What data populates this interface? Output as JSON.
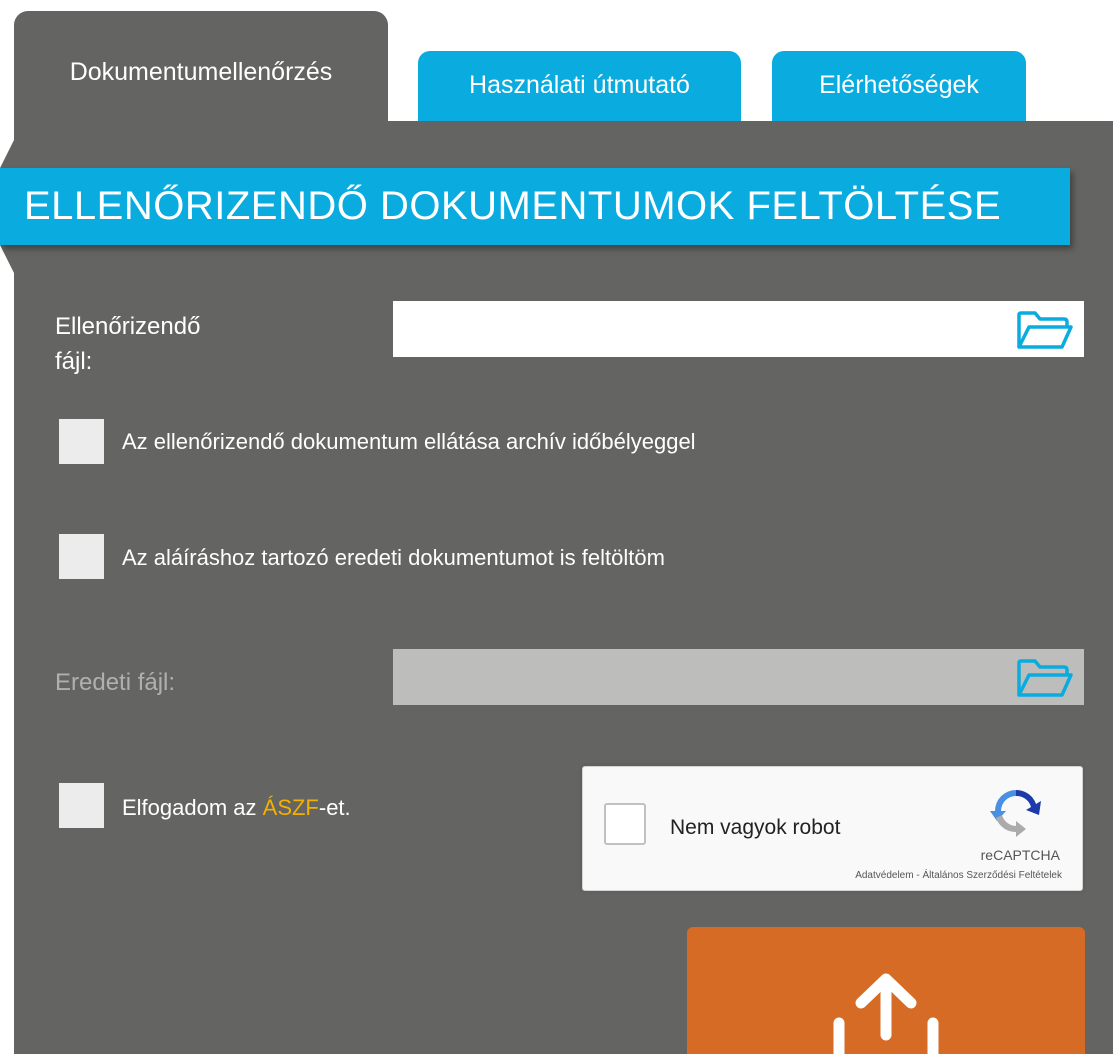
{
  "tabs": [
    {
      "label": "Dokumentumellenőrzés",
      "active": true
    },
    {
      "label": "Használati útmutató",
      "active": false
    },
    {
      "label": "Elérhetőségek",
      "active": false
    }
  ],
  "banner": {
    "title": "ELLENŐRIZENDŐ DOKUMENTUMOK FELTÖLTÉSE"
  },
  "form": {
    "file_label_line1": "Ellenőrizendő",
    "file_label_line2": "fájl:",
    "file_value": "",
    "timestamp_checkbox": {
      "label": "Az ellenőrizendő dokumentum ellátása archív időbélyeggel",
      "checked": false
    },
    "original_checkbox": {
      "label": "Az aláíráshoz tartozó eredeti dokumentumot is feltöltöm",
      "checked": false
    },
    "original_file_label": "Eredeti fájl:",
    "original_file_value": "",
    "terms": {
      "prefix": "Elfogadom az ",
      "link": "ÁSZF",
      "suffix": "-et.",
      "checked": false
    }
  },
  "recaptcha": {
    "label": "Nem vagyok robot",
    "brand": "reCAPTCHA",
    "privacy": "Adatvédelem",
    "separator": " - ",
    "terms": "Általános Szerződési Feltételek"
  },
  "icons": {
    "folder": "folder-open-icon",
    "upload": "upload-icon",
    "recaptcha": "recaptcha-logo-icon"
  },
  "colors": {
    "accent": "#0aabdf",
    "panel": "#646462",
    "upload_button": "#d66b26",
    "link": "#f4b000"
  }
}
